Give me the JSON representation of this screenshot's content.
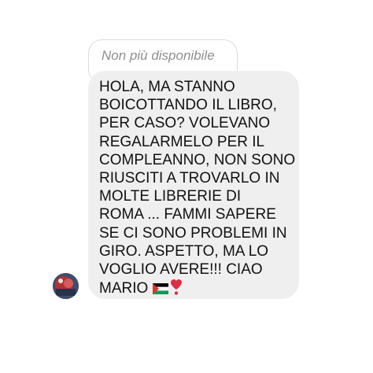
{
  "reply": {
    "text": "Non più disponibile"
  },
  "message": {
    "lines": [
      "HOLA, MA STANNO",
      "BOICOTTANDO IL LIBRO,",
      "PER CASO? VOLEVANO",
      "REGALARMELO PER IL",
      "COMPLEANNO, NON SONO",
      "RIUSCITI A TROVARLO IN",
      "MOLTE LIBRERIE DI",
      "ROMA ... FAMMI SAPERE",
      "SE CI SONO PROBLEMI IN",
      "GIRO. ASPETTO, MA LO",
      "VOGLIO AVERE!!! CIAO",
      "MARIO"
    ],
    "emojis": [
      "palestine-flag-icon",
      "red-heart-exclamation-icon"
    ]
  },
  "colors": {
    "bubble": "#efefef",
    "reply_border": "#dbdbdb",
    "reply_text": "#8e8e8e",
    "message_text": "#111111"
  }
}
